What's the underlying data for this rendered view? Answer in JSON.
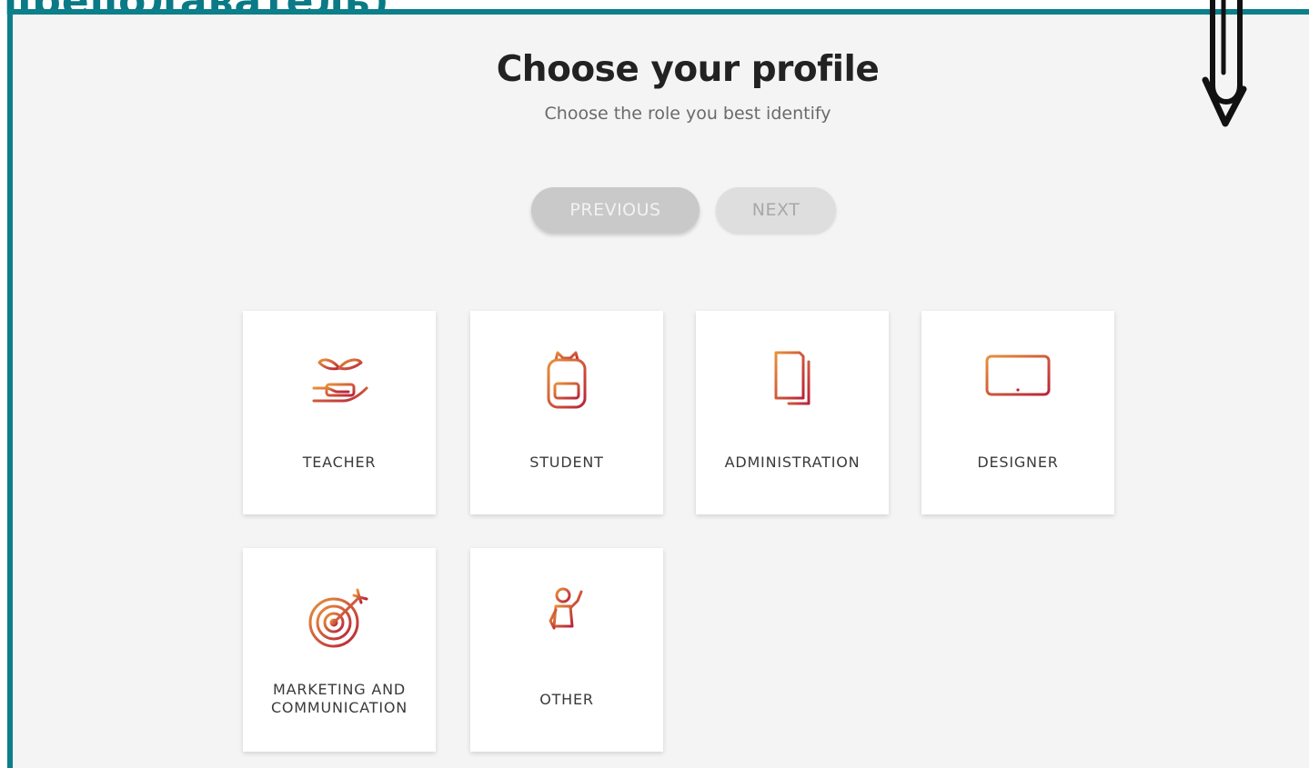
{
  "slide": {
    "title_fragment": "преподаватель)"
  },
  "page": {
    "heading": "Choose your profile",
    "subheading": "Choose the role you best identify"
  },
  "nav": {
    "previous_label": "PREVIOUS",
    "next_label": "NEXT"
  },
  "profiles": [
    {
      "label": "TEACHER",
      "icon": "plant-hand-icon"
    },
    {
      "label": "STUDENT",
      "icon": "backpack-icon"
    },
    {
      "label": "ADMINISTRATION",
      "icon": "documents-icon"
    },
    {
      "label": "DESIGNER",
      "icon": "monitor-icon"
    },
    {
      "label": "MARKETING AND COMMUNICATION",
      "icon": "target-icon"
    },
    {
      "label": "OTHER",
      "icon": "person-waving-icon"
    }
  ],
  "colors": {
    "accent_teal": "#0b7f8a",
    "icon_red": "#c0392b",
    "icon_orange": "#e8913a"
  }
}
